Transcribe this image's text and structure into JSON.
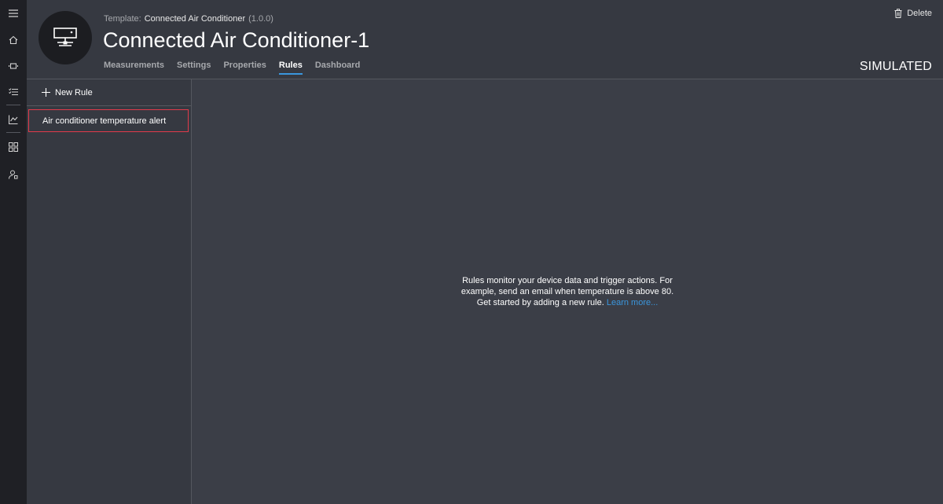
{
  "nav": {
    "items": [
      {
        "name": "menu-icon"
      },
      {
        "name": "home-icon"
      },
      {
        "name": "devices-icon"
      },
      {
        "name": "device-templates-icon"
      },
      {
        "name": "analytics-icon"
      },
      {
        "name": "dashboards-icon"
      },
      {
        "name": "administration-icon"
      }
    ]
  },
  "header": {
    "template_label": "Template:",
    "template_name": "Connected Air Conditioner",
    "template_version": "(1.0.0)",
    "title": "Connected Air Conditioner-1",
    "tabs": [
      {
        "label": "Measurements",
        "active": false
      },
      {
        "label": "Settings",
        "active": false
      },
      {
        "label": "Properties",
        "active": false
      },
      {
        "label": "Rules",
        "active": true
      },
      {
        "label": "Dashboard",
        "active": false
      }
    ],
    "delete_label": "Delete",
    "status": "SIMULATED"
  },
  "rules": {
    "new_rule_label": "New Rule",
    "items": [
      {
        "label": "Air conditioner temperature alert"
      }
    ]
  },
  "empty_state": {
    "text": "Rules monitor your device data and trigger actions. For example, send an email when temperature is above 80. Get started by adding a new rule.",
    "link": "Learn more..."
  },
  "colors": {
    "accent": "#3a96dd",
    "highlight": "#e23b4b",
    "rail": "#1f2025",
    "background": "#3b3e47"
  }
}
